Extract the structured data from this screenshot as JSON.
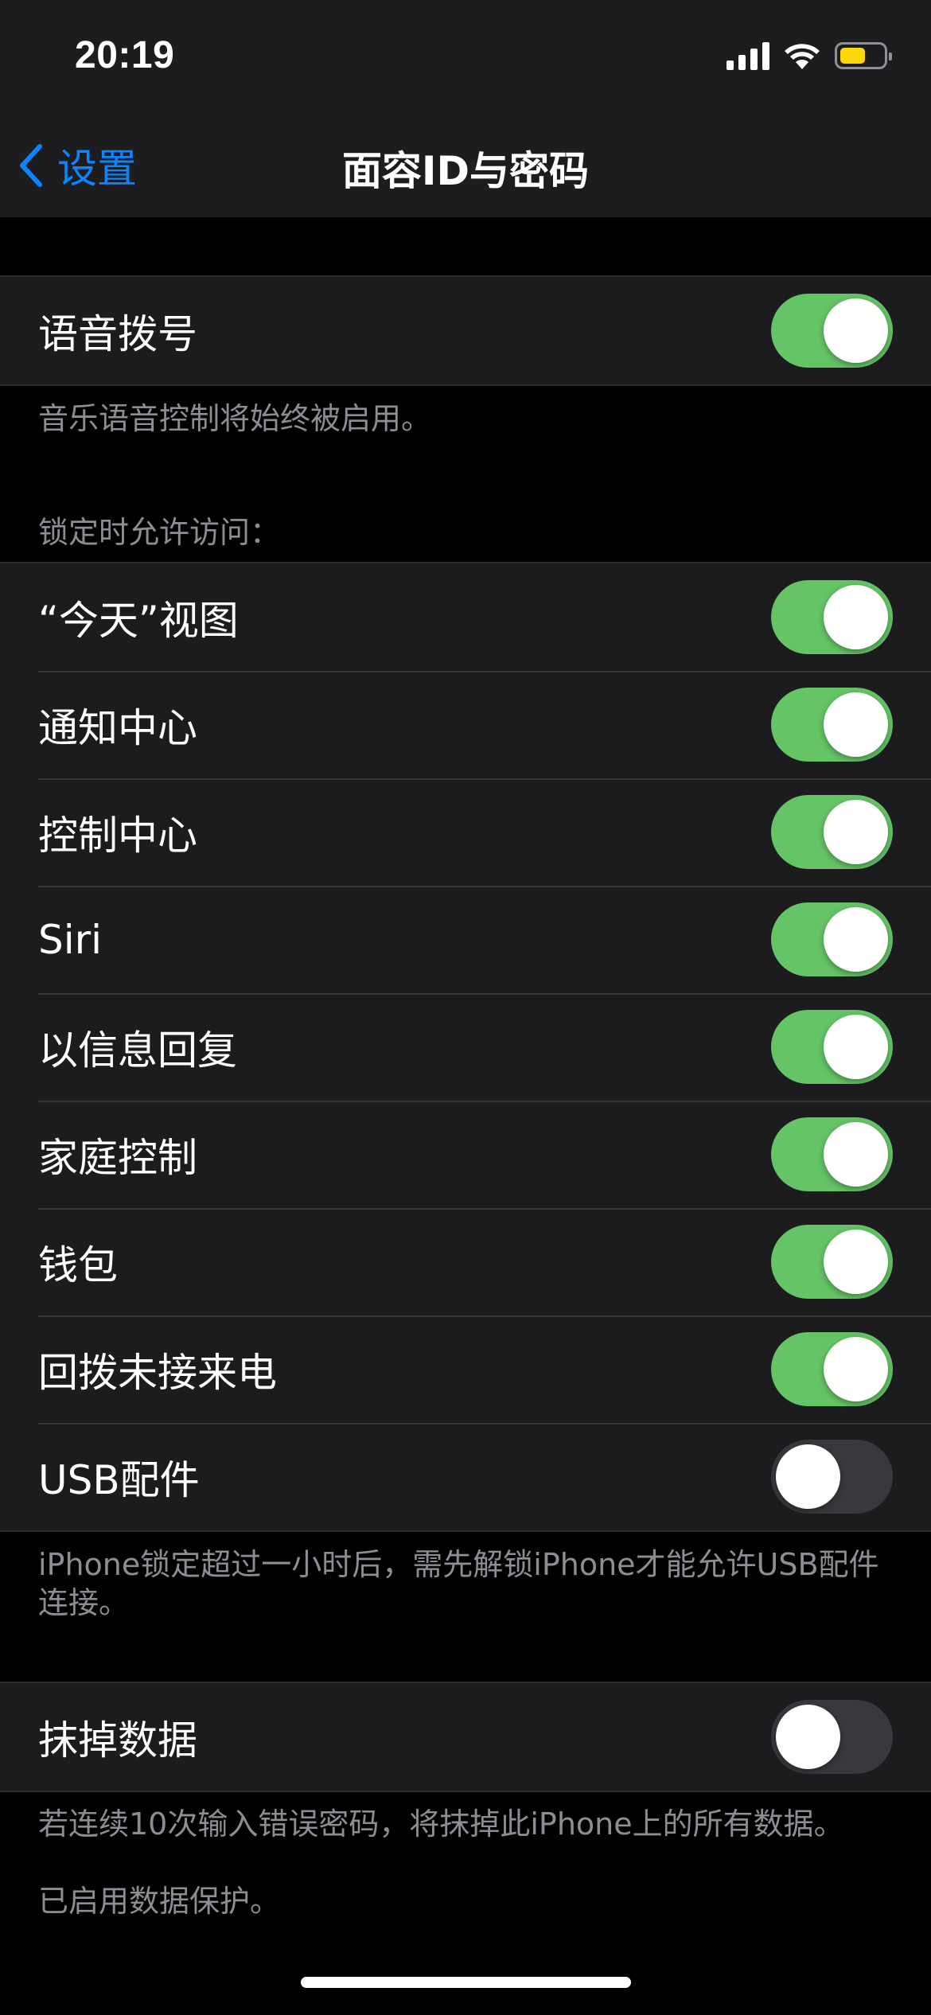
{
  "status_bar": {
    "time": "20:19",
    "signal_bars": 4,
    "battery_level": 0.6
  },
  "nav": {
    "back_label": "设置",
    "title": "面容ID与密码"
  },
  "voice_dial": {
    "label": "语音拨号",
    "on": true,
    "footnote": "音乐语音控制将始终被启用。"
  },
  "lock_access": {
    "header": "锁定时允许访问：",
    "items": [
      {
        "label": "“今天”视图",
        "on": true
      },
      {
        "label": "通知中心",
        "on": true
      },
      {
        "label": "控制中心",
        "on": true
      },
      {
        "label": "Siri",
        "on": true
      },
      {
        "label": "以信息回复",
        "on": true
      },
      {
        "label": "家庭控制",
        "on": true
      },
      {
        "label": "钱包",
        "on": true
      },
      {
        "label": "回拨未接来电",
        "on": true
      },
      {
        "label": "USB配件",
        "on": false
      }
    ],
    "footnote": "iPhone锁定超过一小时后，需先解锁iPhone才能允许USB配件连接。"
  },
  "erase_data": {
    "label": "抹掉数据",
    "on": false,
    "footnote_1": "若连续10次输入错误密码，将抹掉此iPhone上的所有数据。",
    "footnote_2": "已启用数据保护。"
  },
  "colors": {
    "accent": "#0a84ff",
    "toggle_on": "#65c466",
    "toggle_off": "#39393d",
    "battery": "#ffd60a"
  }
}
